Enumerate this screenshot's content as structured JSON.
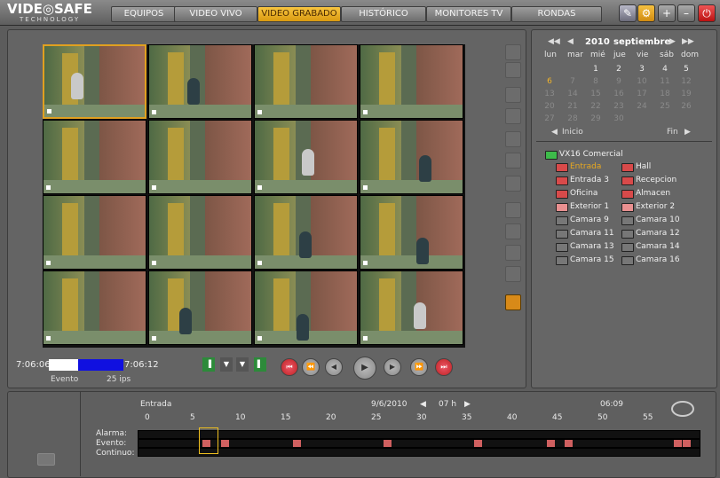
{
  "brand": {
    "line1": "VIDE◎SAFE",
    "line2": "TECHNOLOGY"
  },
  "nav": [
    {
      "label": "EQUIPOS",
      "active": false
    },
    {
      "label": "VIDEO VIVO",
      "active": false
    },
    {
      "label": "VIDEO GRABADO",
      "active": true
    },
    {
      "label": "HISTÓRICO",
      "active": false
    },
    {
      "label": "MONITORES TV",
      "active": false
    },
    {
      "label": "RONDAS",
      "active": false
    }
  ],
  "toolbar_icons": [
    "wand-icon",
    "power-settings-icon",
    "plus-icon",
    "minimize-icon",
    "power-icon"
  ],
  "playback": {
    "start_time": "7:06:06",
    "end_time": "7:06:12",
    "mode_label": "Evento",
    "fps_label": "25 ips",
    "progress_fraction": 0.61
  },
  "calendar": {
    "year": "2010",
    "month": "septiembre",
    "weekdays": [
      "lun",
      "mar",
      "mié",
      "jue",
      "vie",
      "sáb",
      "dom"
    ],
    "weeks": [
      [
        "",
        "",
        "1",
        "2",
        "3",
        "4",
        "5"
      ],
      [
        "6",
        "7",
        "8",
        "9",
        "10",
        "11",
        "12"
      ],
      [
        "13",
        "14",
        "15",
        "16",
        "17",
        "18",
        "19"
      ],
      [
        "20",
        "21",
        "22",
        "23",
        "24",
        "25",
        "26"
      ],
      [
        "27",
        "28",
        "29",
        "30",
        "",
        "",
        ""
      ]
    ],
    "today": "6",
    "start_label": "Inicio",
    "end_label": "Fin"
  },
  "device": {
    "name": "VX16 Comercial"
  },
  "channels": [
    {
      "label": "Entrada",
      "color": "#d84a4a",
      "active": true
    },
    {
      "label": "Hall",
      "color": "#d84a4a"
    },
    {
      "label": "Entrada 3",
      "color": "#d84a4a"
    },
    {
      "label": "Recepcion",
      "color": "#d84a4a"
    },
    {
      "label": "Oficina",
      "color": "#d84a4a"
    },
    {
      "label": "Almacen",
      "color": "#d84a4a"
    },
    {
      "label": "Exterior 1",
      "color": "#e99090"
    },
    {
      "label": "Exterior 2",
      "color": "#e99090"
    },
    {
      "label": "Camara 9",
      "color": "#777777"
    },
    {
      "label": "Camara 10",
      "color": "#777777"
    },
    {
      "label": "Camara 11",
      "color": "#777777"
    },
    {
      "label": "Camara 12",
      "color": "#777777"
    },
    {
      "label": "Camara 13",
      "color": "#777777"
    },
    {
      "label": "Camara 14",
      "color": "#777777"
    },
    {
      "label": "Camara 15",
      "color": "#777777"
    },
    {
      "label": "Camara 16",
      "color": "#777777"
    }
  ],
  "timeline": {
    "channel": "Entrada",
    "date": "9/6/2010",
    "hour": "07 h",
    "time": "06:09",
    "ticks": [
      "0",
      "5",
      "10",
      "15",
      "20",
      "25",
      "30",
      "35",
      "40",
      "45",
      "50",
      "55"
    ],
    "rows": [
      "Alarma:",
      "Evento:",
      "Continuo:"
    ],
    "cursor_minute": 6,
    "events_minutes": [
      6,
      8,
      16,
      26,
      36,
      44,
      46,
      58,
      59
    ]
  },
  "accent": "#e8a820"
}
